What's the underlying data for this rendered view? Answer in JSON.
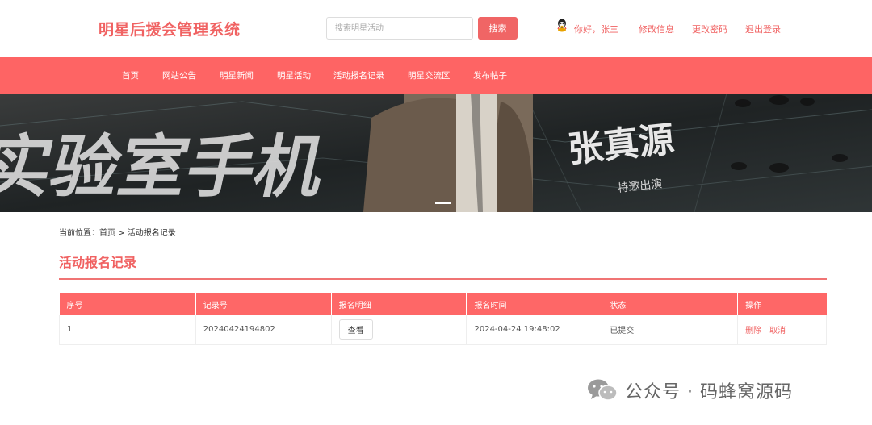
{
  "header": {
    "site_title": "明星后援会管理系统",
    "search_placeholder": "搜索明星活动",
    "search_button": "搜索",
    "greeting": "你好，张三",
    "edit_info": "修改信息",
    "change_password": "更改密码",
    "logout": "退出登录"
  },
  "nav": {
    "items": [
      "首页",
      "网站公告",
      "明星新闻",
      "明星活动",
      "活动报名记录",
      "明星交流区",
      "发布帖子"
    ]
  },
  "banner": {
    "text_left": "实验室手机",
    "text_name": "张真源",
    "text_sub": "特邀出演"
  },
  "breadcrumb": {
    "prefix": "当前位置：",
    "home": "首页",
    "separator": " > ",
    "current": "活动报名记录"
  },
  "page_title": "活动报名记录",
  "table": {
    "headers": [
      "序号",
      "记录号",
      "报名明细",
      "报名时间",
      "状态",
      "操作"
    ],
    "rows": [
      {
        "index": "1",
        "record_no": "20240424194802",
        "detail_button": "查看",
        "time": "2024-04-24 19:48:02",
        "status": "已提交",
        "delete": "删除",
        "cancel": "取消"
      }
    ]
  },
  "watermark": {
    "text": "公众号 · 码蜂窝源码"
  },
  "colors": {
    "accent": "#fe6464",
    "title": "#f06262"
  }
}
